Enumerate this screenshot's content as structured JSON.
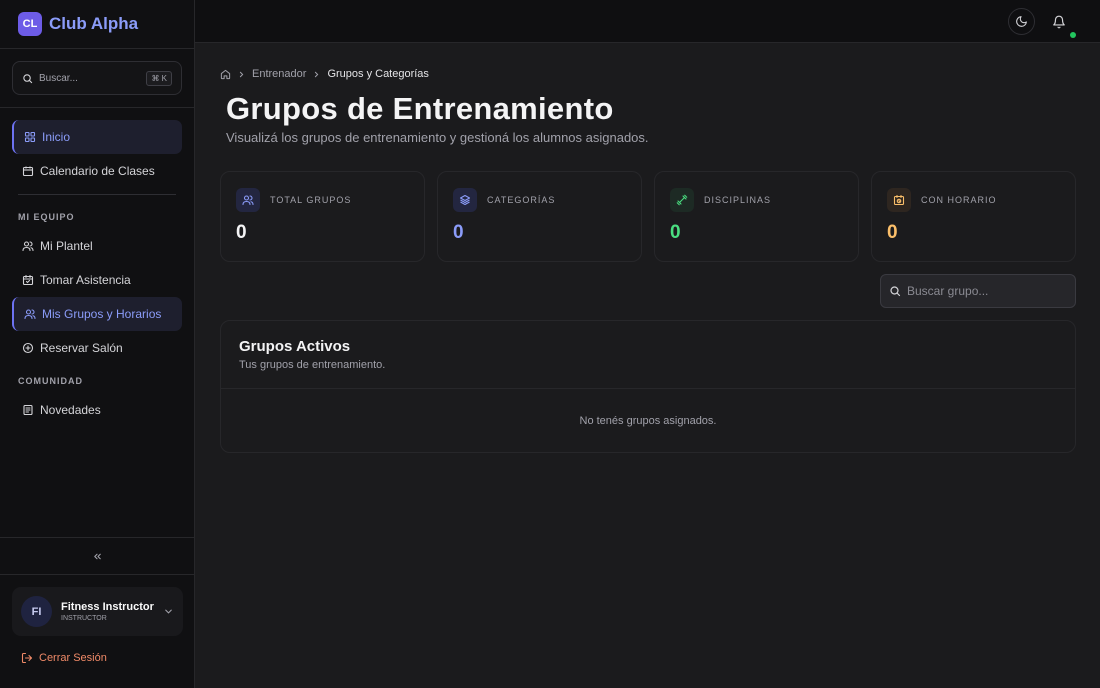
{
  "brand": {
    "logo_text": "CL",
    "name": "Club Alpha"
  },
  "sidebar_search": {
    "placeholder": "Buscar...",
    "shortcut": "⌘ K"
  },
  "nav_main": [
    {
      "label": "Inicio",
      "icon": "grid-icon",
      "active": true
    },
    {
      "label": "Calendario de Clases",
      "icon": "calendar-icon",
      "active": false
    }
  ],
  "section_team": {
    "label": "MI EQUIPO",
    "items": [
      {
        "label": "Mi Plantel",
        "icon": "users-icon",
        "active": false
      },
      {
        "label": "Tomar Asistencia",
        "icon": "calendar-check-icon",
        "active": false
      },
      {
        "label": "Mis Grupos y Horarios",
        "icon": "users-icon",
        "active": true
      },
      {
        "label": "Reservar Salón",
        "icon": "plus-circle-icon",
        "active": false
      }
    ]
  },
  "section_community": {
    "label": "COMUNIDAD",
    "items": [
      {
        "label": "Novedades",
        "icon": "newspaper-icon",
        "active": false
      }
    ]
  },
  "user": {
    "initials": "FI",
    "name": "Fitness Instructor",
    "role": "INSTRUCTOR"
  },
  "logout_label": "Cerrar Sesión",
  "breadcrumb": {
    "parent": "Entrenador",
    "current": "Grupos y Categorías"
  },
  "page": {
    "title": "Grupos de Entrenamiento",
    "subtitle": "Visualizá los grupos de entrenamiento y gestioná los alumnos asignados."
  },
  "stats": [
    {
      "label": "TOTAL GRUPOS",
      "value": "0",
      "color": "#f4f4f5",
      "icon": "users-icon"
    },
    {
      "label": "CATEGORÍAS",
      "value": "0",
      "color": "#8b9cf9",
      "icon": "layers-icon"
    },
    {
      "label": "DISCIPLINAS",
      "value": "0",
      "color": "#4ade80",
      "icon": "dumbbell-icon"
    },
    {
      "label": "CON HORARIO",
      "value": "0",
      "color": "#fbbf6a",
      "icon": "calendar-clock-icon"
    }
  ],
  "group_search": {
    "placeholder": "Buscar grupo..."
  },
  "panel": {
    "title": "Grupos Activos",
    "subtitle": "Tus grupos de entrenamiento.",
    "empty": "No tenés grupos asignados."
  },
  "colors": {
    "accent": "#6d72f2",
    "accent_text": "#8b9cf9",
    "logout": "#f08a68",
    "online": "#22c55e"
  }
}
